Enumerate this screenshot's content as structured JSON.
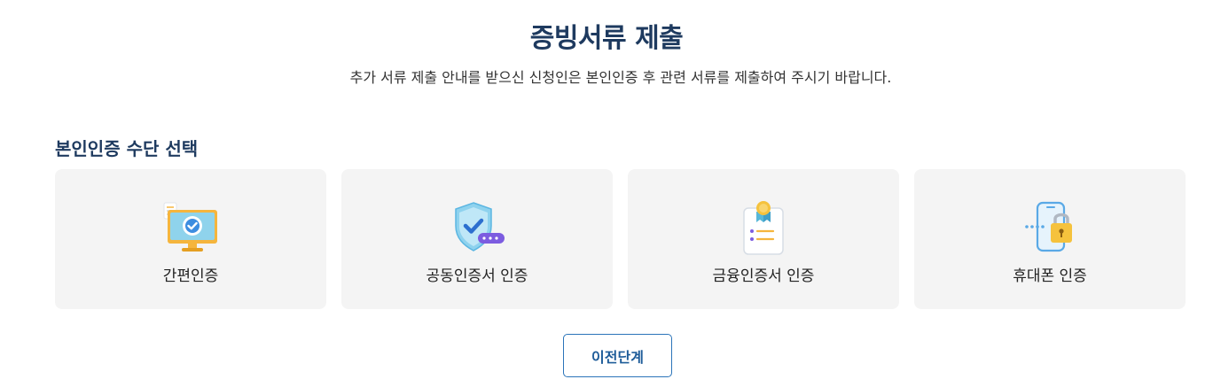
{
  "header": {
    "title": "증빙서류 제출",
    "description": "추가 서류 제출 안내를 받으신 신청인은 본인인증 후 관련 서류를 제출하여 주시기 바랍니다."
  },
  "auth_section": {
    "title": "본인인증 수단 선택",
    "options": [
      {
        "label": "간편인증",
        "icon": "monitor-check-icon"
      },
      {
        "label": "공동인증서 인증",
        "icon": "shield-check-icon"
      },
      {
        "label": "금융인증서 인증",
        "icon": "certificate-clipboard-icon"
      },
      {
        "label": "휴대폰 인증",
        "icon": "phone-lock-icon"
      }
    ]
  },
  "footer": {
    "prev_label": "이전단계"
  },
  "colors": {
    "title": "#1e3a5f",
    "card_bg": "#f4f4f4",
    "button_border": "#2b74b9"
  }
}
